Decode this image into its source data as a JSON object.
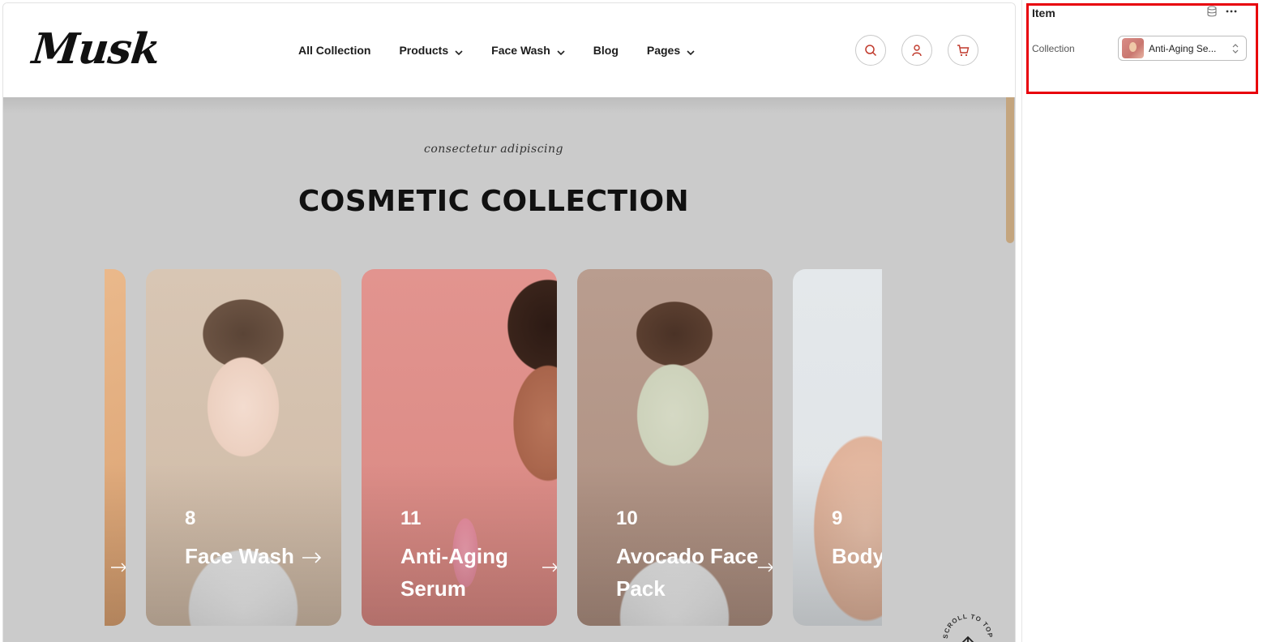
{
  "site": {
    "logo": "Musk",
    "nav": [
      {
        "label": "All Collection",
        "dropdown": false
      },
      {
        "label": "Products",
        "dropdown": true
      },
      {
        "label": "Face Wash",
        "dropdown": true
      },
      {
        "label": "Blog",
        "dropdown": false
      },
      {
        "label": "Pages",
        "dropdown": true
      }
    ],
    "header_icons": [
      "search-icon",
      "user-icon",
      "cart-icon"
    ],
    "accent_color": "#c0392b"
  },
  "section": {
    "tagline": "consectetur adipiscing",
    "title": "COSMETIC COLLECTION"
  },
  "cards": [
    {
      "number": "",
      "name": "",
      "color": "#e9b58a"
    },
    {
      "number": "8",
      "name": "Face Wash",
      "color": "#d9c3b0"
    },
    {
      "number": "11",
      "name": "Anti-Aging Serum",
      "color": "#d88b86"
    },
    {
      "number": "10",
      "name": "Avocado Face Pack",
      "color": "#b59585"
    },
    {
      "number": "9",
      "name": "Body",
      "color": "#e3e7ea"
    }
  ],
  "scroll_top": {
    "label": "SCROLL TO TOP"
  },
  "panel": {
    "title": "Item",
    "field_label": "Collection",
    "field_value": "Anti-Aging Se...",
    "highlight_color": "#e8000b"
  }
}
